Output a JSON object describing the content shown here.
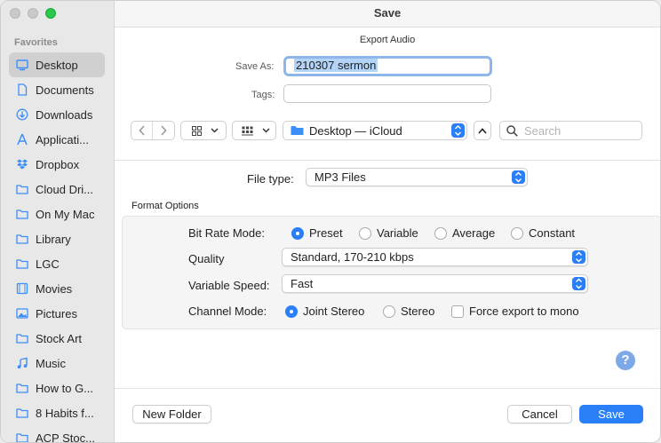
{
  "window": {
    "title": "Save"
  },
  "sidebar": {
    "section_label": "Favorites",
    "items": [
      {
        "label": "Desktop",
        "icon": "desktop-icon",
        "active": true
      },
      {
        "label": "Documents",
        "icon": "document-icon"
      },
      {
        "label": "Downloads",
        "icon": "download-icon"
      },
      {
        "label": "Applicati...",
        "icon": "applications-icon"
      },
      {
        "label": "Dropbox",
        "icon": "dropbox-icon"
      },
      {
        "label": "Cloud Dri...",
        "icon": "folder-icon"
      },
      {
        "label": "On My Mac",
        "icon": "folder-icon"
      },
      {
        "label": "Library",
        "icon": "folder-icon"
      },
      {
        "label": "LGC",
        "icon": "folder-icon"
      },
      {
        "label": "Movies",
        "icon": "movies-icon"
      },
      {
        "label": "Pictures",
        "icon": "pictures-icon"
      },
      {
        "label": "Stock Art",
        "icon": "folder-icon"
      },
      {
        "label": "Music",
        "icon": "music-icon"
      },
      {
        "label": "How to G...",
        "icon": "folder-icon"
      },
      {
        "label": "8 Habits f...",
        "icon": "folder-icon"
      },
      {
        "label": "ACP Stoc...",
        "icon": "folder-icon"
      }
    ]
  },
  "dialog": {
    "subtitle": "Export Audio",
    "save_as_label": "Save As:",
    "save_as_value": "210307 sermon",
    "tags_label": "Tags:",
    "tags_value": "",
    "location": "Desktop — iCloud",
    "search_placeholder": "Search",
    "file_type_label": "File type:",
    "file_type_value": "MP3 Files"
  },
  "format": {
    "section_label": "Format Options",
    "bit_rate_label": "Bit Rate Mode:",
    "bit_rate_options": [
      {
        "label": "Preset",
        "selected": true
      },
      {
        "label": "Variable",
        "selected": false
      },
      {
        "label": "Average",
        "selected": false
      },
      {
        "label": "Constant",
        "selected": false
      }
    ],
    "quality_label": "Quality",
    "quality_value": "Standard, 170-210 kbps",
    "variable_speed_label": "Variable Speed:",
    "variable_speed_value": "Fast",
    "channel_mode_label": "Channel Mode:",
    "channel_options": [
      {
        "label": "Joint Stereo",
        "selected": true
      },
      {
        "label": "Stereo",
        "selected": false
      }
    ],
    "force_mono_label": "Force export to mono",
    "force_mono_checked": false
  },
  "buttons": {
    "new_folder": "New Folder",
    "cancel": "Cancel",
    "save": "Save",
    "help": "?"
  },
  "colors": {
    "accent": "#2b7ff6",
    "help": "#7da9e8"
  }
}
